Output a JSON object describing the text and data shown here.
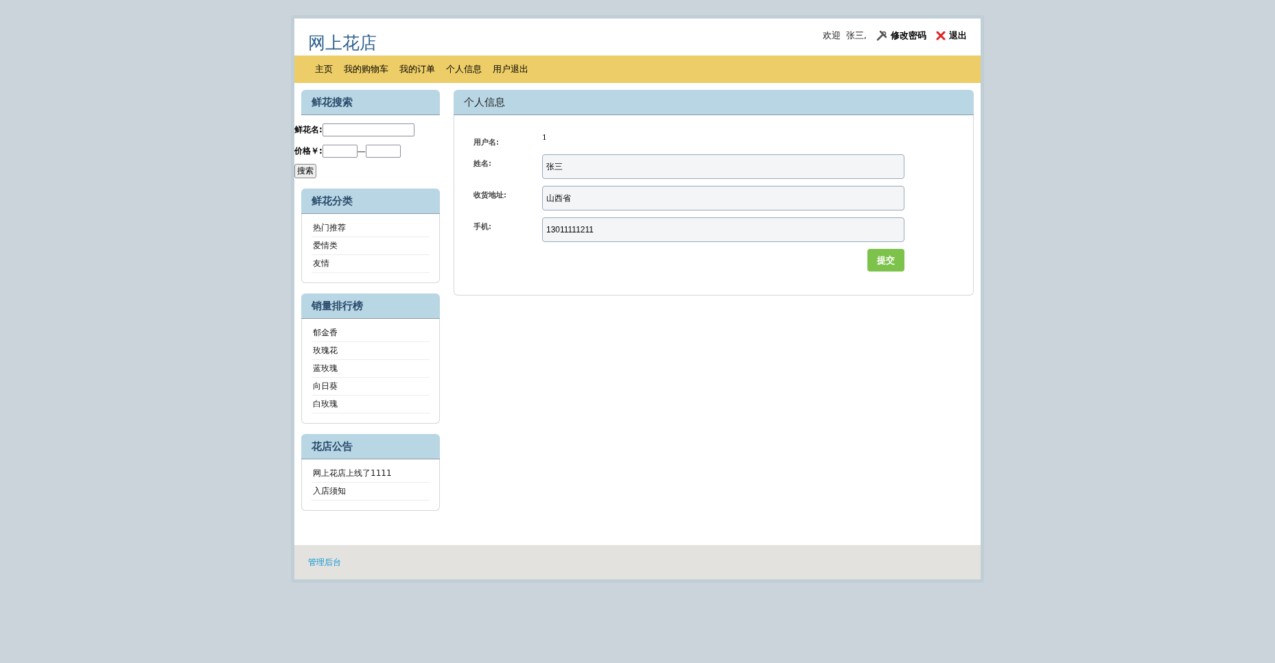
{
  "header": {
    "logo": "网上花店",
    "welcome": "欢迎",
    "user": "张三,",
    "links": [
      {
        "kind": "tools",
        "label": "修改密码"
      },
      {
        "kind": "close",
        "label": "退出"
      }
    ]
  },
  "nav": [
    "主页",
    "我的购物车",
    "我的订单",
    "个人信息",
    "用户退出"
  ],
  "search": {
    "title": "鲜花搜索",
    "name_label": "鲜花名:",
    "price_label": "价格￥:",
    "separator": "—",
    "button": "搜索"
  },
  "sidebar_boxes": [
    {
      "title": "鲜花分类",
      "items": [
        "热门推荐",
        "爱情类",
        "友情"
      ]
    },
    {
      "title": "销量排行榜",
      "items": [
        "郁金香",
        "玫瑰花",
        "蓝玫瑰",
        "向日葵",
        "白玫瑰"
      ]
    },
    {
      "title": "花店公告",
      "items": [
        "网上花店上线了1111",
        "入店须知"
      ]
    }
  ],
  "profile": {
    "title": "个人信息",
    "fields": [
      {
        "kind": "text",
        "label": "用户名:",
        "value": "1"
      },
      {
        "kind": "input",
        "label": "姓名:",
        "value": "张三"
      },
      {
        "kind": "input",
        "label": "收货地址:",
        "value": "山西省"
      },
      {
        "kind": "input",
        "label": "手机:",
        "value": "13011111211"
      }
    ],
    "submit": "提交"
  },
  "footer": {
    "link": "管理后台"
  }
}
